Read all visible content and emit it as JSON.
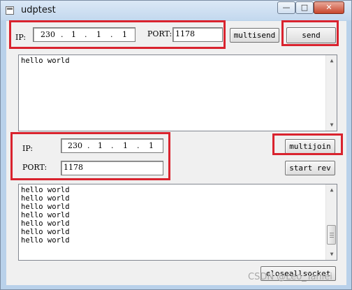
{
  "window": {
    "title": "udptest",
    "minimize_glyph": "—",
    "maximize_glyph": "□",
    "close_glyph": "✕"
  },
  "send_group": {
    "ip_label": "IP:",
    "ip_octets": [
      "230",
      "1",
      "1",
      "1"
    ],
    "port_label": "PORT:",
    "port_value": "1178",
    "multisend_label": "multisend",
    "send_label": "send"
  },
  "send_text": {
    "lines": [
      "hello world"
    ]
  },
  "join_group": {
    "ip_label": "IP:",
    "ip_octets": [
      "230",
      "1",
      "1",
      "1"
    ],
    "port_label": "PORT:",
    "port_value": "1178",
    "multijoin_label": "multijoin",
    "start_rev_label": "start rev"
  },
  "receive_text": {
    "lines": [
      "hello world",
      "hello world",
      "hello world",
      "hello world",
      "hello world",
      "hello world",
      "hello world"
    ]
  },
  "footer": {
    "closeallsocket_label": "closeallsocket",
    "watermark": "CSDN @Leo_Tanlei"
  },
  "colors": {
    "highlight": "#d9232e",
    "window_frame": "#b9d1ea",
    "client_bg": "#f0f0f0"
  }
}
